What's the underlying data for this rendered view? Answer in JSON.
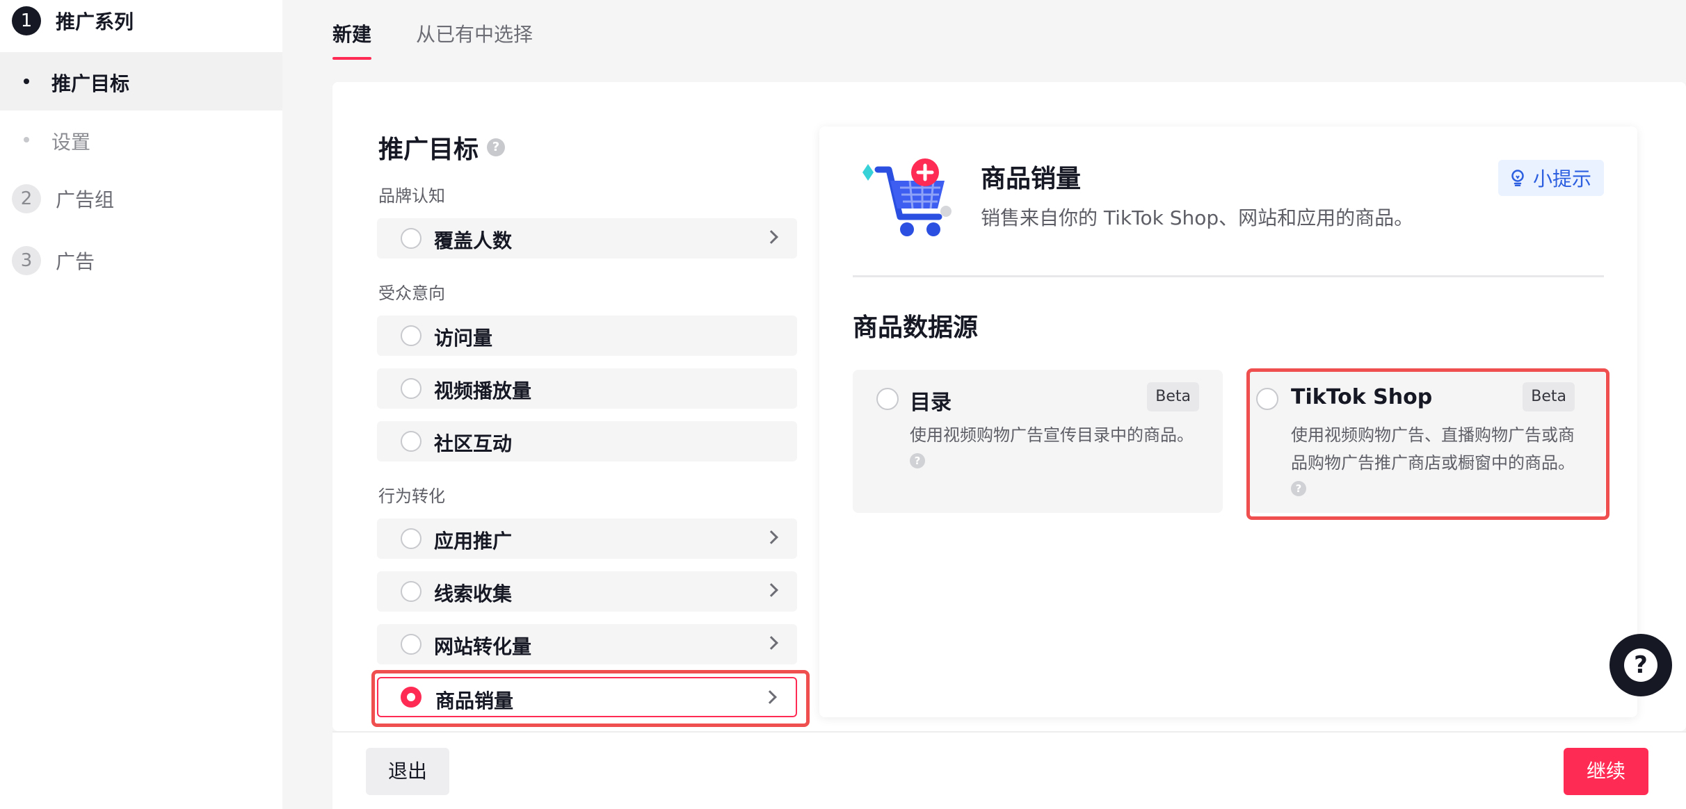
{
  "sidebar": {
    "steps": [
      {
        "num": "1",
        "label": "推广系列"
      },
      {
        "num": "2",
        "label": "广告组"
      },
      {
        "num": "3",
        "label": "广告"
      }
    ],
    "substeps": [
      {
        "label": "推广目标"
      },
      {
        "label": "设置"
      }
    ]
  },
  "tabs": [
    {
      "label": "新建"
    },
    {
      "label": "从已有中选择"
    }
  ],
  "objective": {
    "title": "推广目标",
    "help_icon": "question-icon",
    "groups": [
      {
        "label": "品牌认知",
        "options": [
          {
            "label": "覆盖人数"
          }
        ]
      },
      {
        "label": "受众意向",
        "options": [
          {
            "label": "访问量"
          },
          {
            "label": "视频播放量"
          },
          {
            "label": "社区互动"
          }
        ]
      },
      {
        "label": "行为转化",
        "options": [
          {
            "label": "应用推广"
          },
          {
            "label": "线索收集"
          },
          {
            "label": "网站转化量"
          },
          {
            "label": "商品销量"
          }
        ]
      }
    ],
    "selected": "商品销量"
  },
  "detail": {
    "title": "商品销量",
    "description": "销售来自你的 TikTok Shop、网站和应用的商品。",
    "tip_label": "小提示",
    "data_source_title": "商品数据源",
    "sources": [
      {
        "name": "目录",
        "badge": "Beta",
        "description_lines": [
          "使用视频购物广告宣传目录中的商品。"
        ]
      },
      {
        "name": "TikTok Shop",
        "badge": "Beta",
        "description_lines": [
          "使用视频购物广告、直播购物广告或商",
          "品购物广告推广商店或橱窗中的商品。"
        ]
      }
    ]
  },
  "footer": {
    "exit_label": "退出",
    "continue_label": "继续",
    "help_glyph": "?"
  },
  "colors": {
    "accent": "#fe2c55",
    "highlight": "#ef4f4f",
    "tip_text": "#2b5fe0"
  }
}
